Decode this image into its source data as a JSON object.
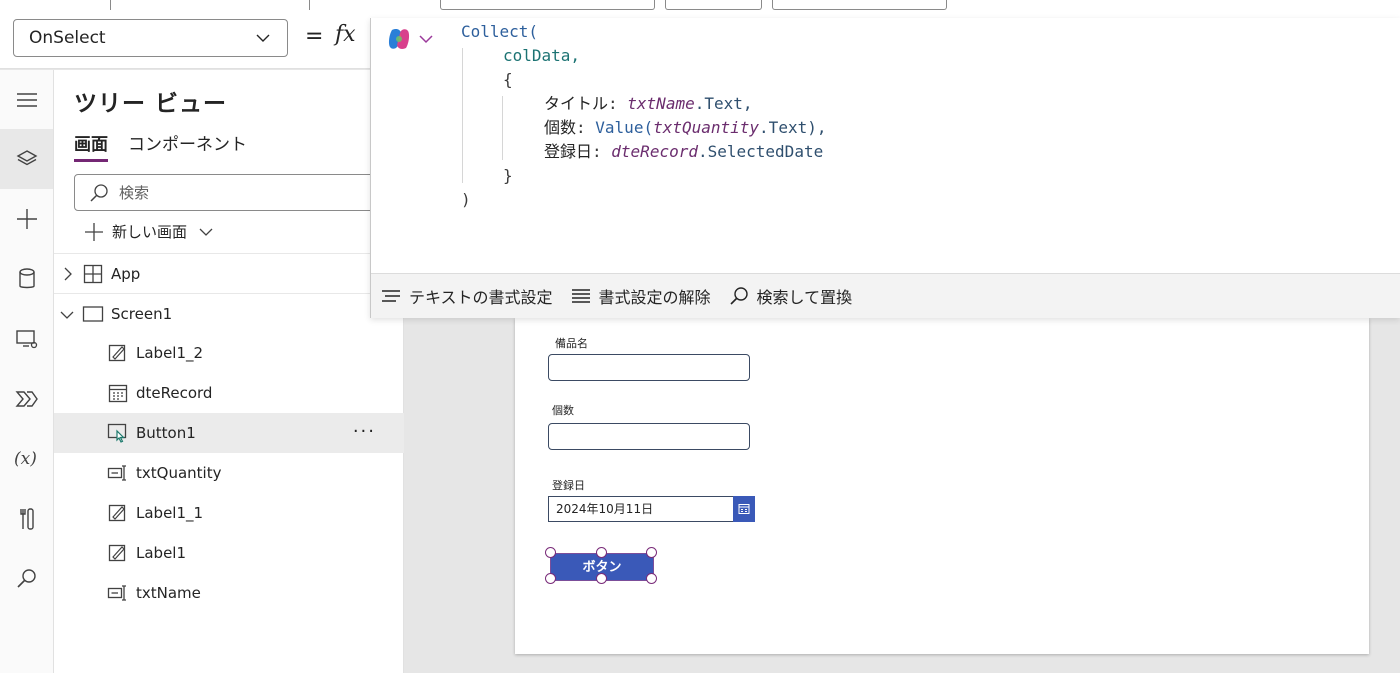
{
  "formula_bar": {
    "property": "OnSelect",
    "equals": "=",
    "fx": "fx"
  },
  "editor": {
    "code": {
      "collect": "Collect(",
      "collection": "colData,",
      "open_brace": "{",
      "f1_name": "タイトル",
      "f1_var": "txtName",
      "f1_prop": ".Text,",
      "f2_name": "個数",
      "f2_fn": "Value(",
      "f2_var": "txtQuantity",
      "f2_prop": ".Text),",
      "f3_name": "登録日",
      "f3_var": "dteRecord",
      "f3_prop": ".SelectedDate",
      "close_brace": "}",
      "close_paren": ")"
    },
    "toolbar": {
      "format_text": "テキストの書式設定",
      "remove_format": "書式設定の解除",
      "find_replace": "検索して置換"
    }
  },
  "tree": {
    "title": "ツリー ビュー",
    "tabs": [
      "画面",
      "コンポーネント"
    ],
    "search_placeholder": "検索",
    "new_screen": "新しい画面",
    "nodes": [
      {
        "label": "App",
        "icon": "app-grid-icon"
      },
      {
        "label": "Screen1",
        "icon": "screen-icon"
      },
      {
        "label": "Label1_2",
        "icon": "label-icon"
      },
      {
        "label": "dteRecord",
        "icon": "calendar-icon"
      },
      {
        "label": "Button1",
        "icon": "button-icon"
      },
      {
        "label": "txtQuantity",
        "icon": "text-input-icon"
      },
      {
        "label": "Label1_1",
        "icon": "label-icon"
      },
      {
        "label": "Label1",
        "icon": "label-icon"
      },
      {
        "label": "txtName",
        "icon": "text-input-icon"
      }
    ],
    "more": "···"
  },
  "canvas": {
    "label_item": "備品名",
    "label_qty": "個数",
    "label_date": "登録日",
    "date_value": "2024年10月11日",
    "button_text": "ボタン"
  },
  "colors": {
    "accent": "#742774",
    "button_blue": "#3a59b8"
  }
}
